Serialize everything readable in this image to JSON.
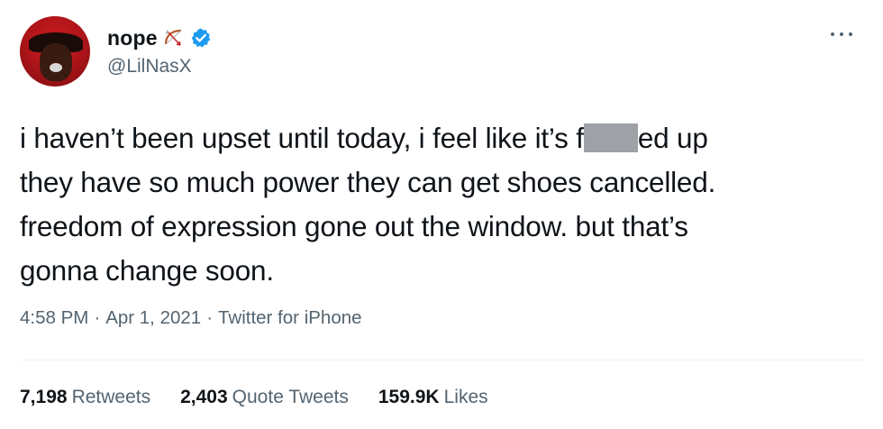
{
  "author": {
    "display_name": "nope",
    "handle": "@LilNasX",
    "name_emoji": "bow-and-arrow-icon",
    "verified": true,
    "verified_color": "#1d9bf0",
    "avatar_color": "#b3151a"
  },
  "tweet": {
    "line1_before": "i haven’t been upset until today, i feel like it’s f",
    "line1_after": "ed up",
    "line2": "they have so much power they can get shoes cancelled.",
    "line3": "freedom of expression gone out the window. but that’s",
    "line4": "gonna change soon."
  },
  "meta": {
    "time": "4:58 PM",
    "separator": "·",
    "date": "Apr 1, 2021",
    "source": "Twitter for iPhone"
  },
  "stats": {
    "retweets_count": "7,198",
    "retweets_label": "Retweets",
    "quote_count": "2,403",
    "quote_label": "Quote Tweets",
    "likes_count": "159.9K",
    "likes_label": "Likes"
  },
  "colors": {
    "text_primary": "#0f1419",
    "text_secondary": "#536471",
    "censor_gray": "#9ea2a6"
  }
}
